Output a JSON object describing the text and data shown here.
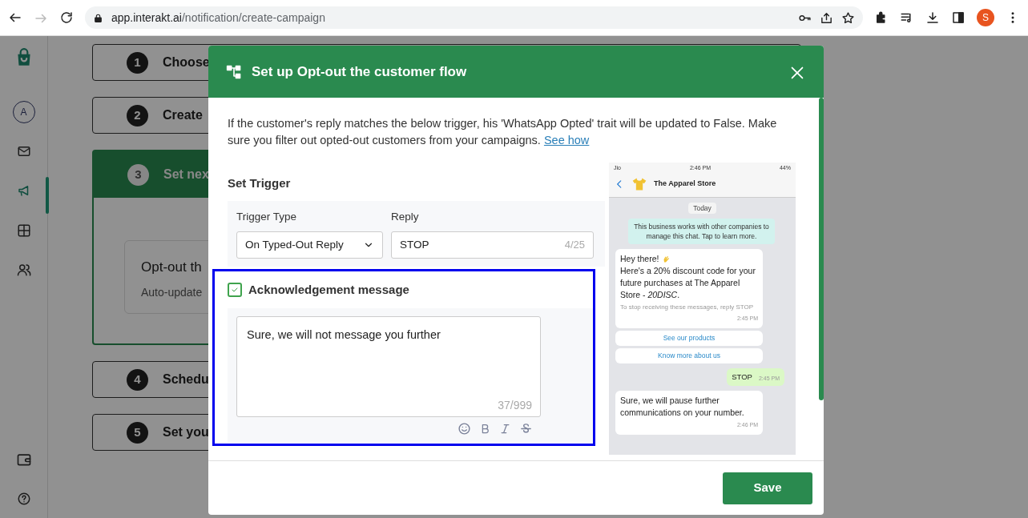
{
  "browser": {
    "url_host": "app.interakt.ai",
    "url_path": "/notification/create-campaign",
    "profile_initial": "S"
  },
  "sidebar": {
    "items": [
      {
        "kind": "avatar",
        "label": "A",
        "selected": false
      },
      {
        "kind": "mail",
        "selected": false
      },
      {
        "kind": "megaphone",
        "selected": true
      },
      {
        "kind": "grid",
        "selected": false
      },
      {
        "kind": "people",
        "selected": false
      }
    ],
    "bottom_items": [
      {
        "kind": "wallet"
      },
      {
        "kind": "help"
      }
    ]
  },
  "steps": [
    {
      "number": "1",
      "title": "Choose",
      "expanded": false
    },
    {
      "number": "2",
      "title": "Create",
      "expanded": false
    },
    {
      "number": "3",
      "title": "Set nex",
      "expanded": true,
      "card": {
        "title": "Opt-out th",
        "subtitle": "Auto-update"
      }
    },
    {
      "number": "4",
      "title": "Schedu",
      "expanded": false
    },
    {
      "number": "5",
      "title": "Set you",
      "expanded": false
    }
  ],
  "modal": {
    "title": "Set up Opt-out the customer flow",
    "description": "If the customer's reply matches the below trigger, his 'WhatsApp Opted' trait will be updated to False. Make sure you filter out opted-out customers from your campaigns.",
    "description_link": "See how",
    "section_title": "Set Trigger",
    "trigger_type": {
      "label": "Trigger Type",
      "value": "On Typed-Out Reply"
    },
    "reply": {
      "label": "Reply",
      "value": "STOP",
      "counter": "4/25"
    },
    "acknowledgement": {
      "label": "Acknowledgement message",
      "checked": true,
      "highlighted": true,
      "message": "Sure, we will not message you further",
      "counter": "37/999"
    },
    "preview": {
      "carrier": "Jio",
      "time": "2:46 PM",
      "battery": "44%",
      "contact": "The Apparel Store",
      "date_chip": "Today",
      "notice": "This business works with other companies to manage this chat. Tap to learn more.",
      "messages": [
        {
          "kind": "incoming",
          "greeting": "Hey there!",
          "text": "Here's a 20% discount code for your future purchases at The Apparel Store - *20DISC*.",
          "footer": "To stop receiving these messages, reply STOP",
          "time": "2:45 PM",
          "buttons": [
            "See our products",
            "Know more about us"
          ]
        },
        {
          "kind": "outgoing",
          "text": "STOP",
          "time": "2:45 PM"
        },
        {
          "kind": "incoming",
          "text": "Sure, we will pause further communications on your number.",
          "time": "2:46 PM"
        }
      ]
    },
    "save_label": "Save"
  }
}
